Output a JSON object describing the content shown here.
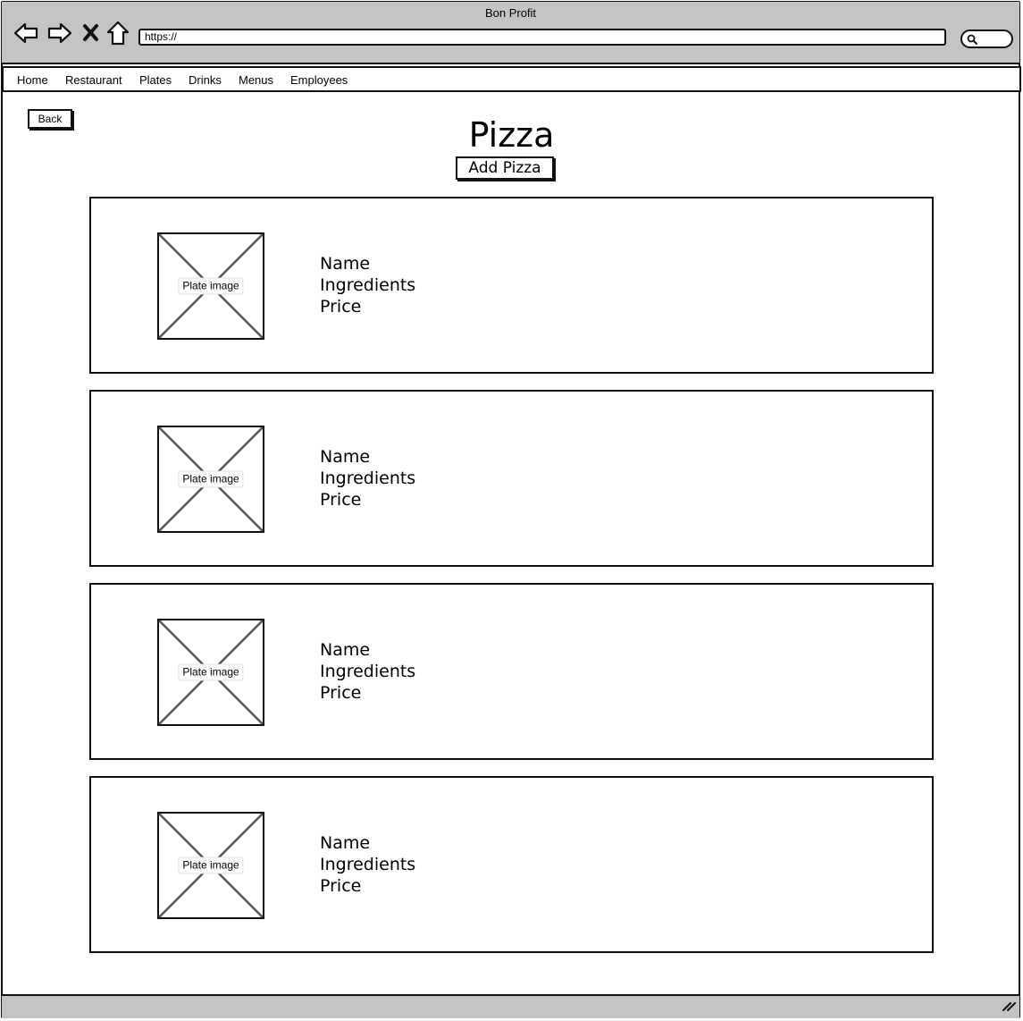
{
  "window": {
    "title": "Bon Profit"
  },
  "address_bar": {
    "url": "https://"
  },
  "icons": {
    "back": "arrow-left-icon",
    "forward": "arrow-right-icon",
    "stop": "close-icon",
    "home": "home-icon",
    "search": "search-icon",
    "resize": "resize-grip-icon"
  },
  "menu": {
    "items": [
      "Home",
      "Restaurant",
      "Plates",
      "Drinks",
      "Menus",
      "Employees"
    ]
  },
  "page": {
    "back_label": "Back",
    "title": "Pizza",
    "add_label": "Add Pizza"
  },
  "plates": [
    {
      "image_label": "Plate image",
      "name": "Name",
      "ingredients": "Ingredients",
      "price": "Price"
    },
    {
      "image_label": "Plate image",
      "name": "Name",
      "ingredients": "Ingredients",
      "price": "Price"
    },
    {
      "image_label": "Plate image",
      "name": "Name",
      "ingredients": "Ingredients",
      "price": "Price"
    },
    {
      "image_label": "Plate image",
      "name": "Name",
      "ingredients": "Ingredients",
      "price": "Price"
    }
  ],
  "colors": {
    "chrome": "#c4c4c4",
    "border": "#111111",
    "placeholder_cross": "#555555"
  }
}
